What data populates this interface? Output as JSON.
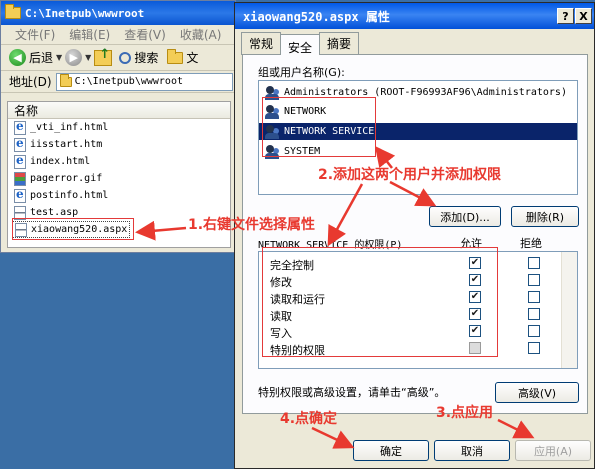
{
  "explorer": {
    "title": "C:\\Inetpub\\wwwroot",
    "menu": [
      "文件(F)",
      "编辑(E)",
      "查看(V)",
      "收藏(A)"
    ],
    "toolbar": {
      "back": "后退",
      "search": "搜索",
      "folders": "文"
    },
    "address_label": "地址(D)",
    "address_value": "C:\\Inetpub\\wwwroot",
    "column_name": "名称",
    "files": [
      {
        "name": "_vti_inf.html",
        "icon": "ie-html-icon"
      },
      {
        "name": "iisstart.htm",
        "icon": "ie-html-icon"
      },
      {
        "name": "index.html",
        "icon": "ie-html-icon"
      },
      {
        "name": "pagerror.gif",
        "icon": "gif-image-icon"
      },
      {
        "name": "postinfo.html",
        "icon": "ie-html-icon"
      },
      {
        "name": "test.asp",
        "icon": "asp-file-icon"
      },
      {
        "name": "xiaowang520.aspx",
        "icon": "aspx-file-icon"
      }
    ]
  },
  "dialog": {
    "title": "xiaowang520.aspx 属性",
    "help_button": "?",
    "close_button": "X",
    "tabs": [
      "常规",
      "安全",
      "摘要"
    ],
    "active_tab": 1,
    "users_label": "组或用户名称(G):",
    "users": [
      "Administrators (ROOT-F96993AF96\\Administrators)",
      "NETWORK",
      "NETWORK SERVICE",
      "SYSTEM"
    ],
    "selected_user_index": 2,
    "add_button": "添加(D)...",
    "remove_button": "删除(R)",
    "perm_label": "NETWORK SERVICE 的权限(P)",
    "allow_label": "允许",
    "deny_label": "拒绝",
    "permissions": [
      {
        "name": "完全控制",
        "allow": true,
        "deny": false
      },
      {
        "name": "修改",
        "allow": true,
        "deny": false
      },
      {
        "name": "读取和运行",
        "allow": true,
        "deny": false
      },
      {
        "name": "读取",
        "allow": true,
        "deny": false
      },
      {
        "name": "写入",
        "allow": true,
        "deny": false
      },
      {
        "name": "特别的权限",
        "allow": false,
        "deny": false,
        "disabled": true
      }
    ],
    "advanced_hint": "特别权限或高级设置，请单击“高级”。",
    "advanced_button": "高级(V)",
    "ok_button": "确定",
    "cancel_button": "取消",
    "apply_button": "应用(A)"
  },
  "annotations": {
    "step1": "1.右键文件选择属性",
    "step2": "2.添加这两个用户并添加权限",
    "step3": "3.点应用",
    "step4": "4.点确定",
    "color": "#e8392f"
  }
}
